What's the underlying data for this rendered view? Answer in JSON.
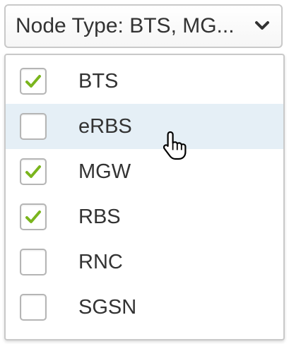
{
  "dropdown": {
    "label": "Node Type: BTS, MG...",
    "chevron_icon": "chevron-down-icon"
  },
  "options": [
    {
      "label": "BTS",
      "checked": true,
      "hover": false
    },
    {
      "label": "eRBS",
      "checked": false,
      "hover": true
    },
    {
      "label": "MGW",
      "checked": true,
      "hover": false
    },
    {
      "label": "RBS",
      "checked": true,
      "hover": false
    },
    {
      "label": "RNC",
      "checked": false,
      "hover": false
    },
    {
      "label": "SGSN",
      "checked": false,
      "hover": false
    }
  ],
  "colors": {
    "check": "#7ab51d",
    "hover_row": "#e5eff6",
    "border": "#c9c9c9",
    "text": "#333333"
  },
  "cursor_icon": "hand-pointer-icon"
}
